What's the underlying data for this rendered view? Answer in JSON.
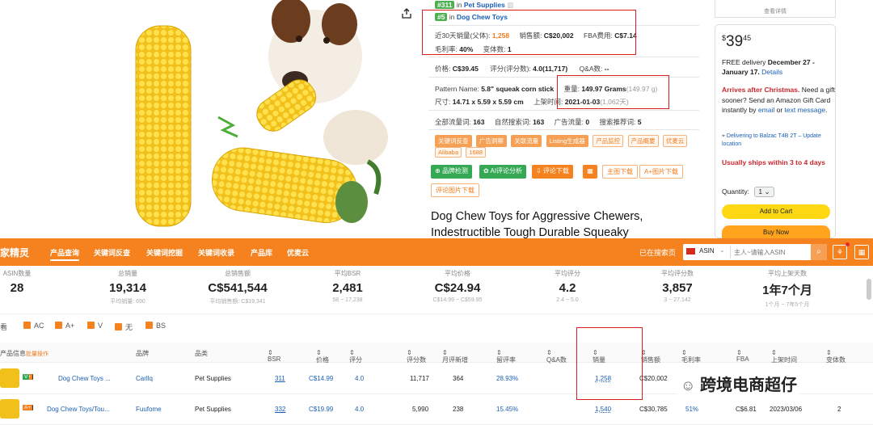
{
  "info": {
    "rank1_tag": "#311",
    "rank1_text": "in",
    "rank1_cat": "Pet Supplies",
    "rank2_tag": "#5",
    "rank2_text": "in",
    "rank2_cat": "Dog Chew Toys",
    "sales30_label": "近30天销量(父体):",
    "sales30_val": "1,258",
    "revenue_label": "销售额:",
    "revenue_val": "C$20,002",
    "fba_label": "FBA费用:",
    "fba_val": "C$7.14",
    "margin_label": "毛利率:",
    "margin_val": "40%",
    "variants_label": "变体数:",
    "variants_val": "1",
    "price_label": "价格:",
    "price_val": "C$39.45",
    "rating_label": "评分(评分数):",
    "rating_val": "4.0(11,717)",
    "qa_label": "Q&A数:",
    "qa_val": "--",
    "pattern_label": "Pattern Name:",
    "pattern_val": "5.8\" squeak corn stick",
    "weight_label": "重量:",
    "weight_val": "149.97 Grams",
    "weight_sub": "(149.97 g)",
    "size_label": "尺寸:",
    "size_val": "14.71 x 5.59 x 5.59 cm",
    "date_label": "上架时间:",
    "date_val": "2021-01-03",
    "date_sub": "(1,062天)",
    "traffic_label": "全部流量词:",
    "traffic_val": "163",
    "organic_label": "自然搜索词:",
    "organic_val": "163",
    "ads_label": "广告流量:",
    "ads_val": "0",
    "rec_label": "搜索推荐词:",
    "rec_val": "5",
    "chips": [
      "关键词反查",
      "广告洞察",
      "关联流量",
      "Listing生成器",
      "产品监控",
      "产品概要",
      "优麦云",
      "Alibaba",
      "1688"
    ],
    "btn_brand": "品牌检测",
    "btn_ai": "AI评论分析",
    "btn_reviews": "评论下载",
    "btn_main": "主图下载",
    "btn_aplus": "A+图片下载",
    "btn_review_img": "评论图片下载"
  },
  "product_title_line1": "Dog Chew Toys for Aggressive Chewers,",
  "product_title_line2": "Indestructible Tough Durable Squeaky",
  "buybox": {
    "top_link": "查看详情",
    "price_sym": "$",
    "price_whole": "39",
    "price_frac": "45",
    "delivery_a": "FREE delivery",
    "delivery_b": "December 27 - January 17.",
    "details": "Details",
    "christmas_a": "Arrives after Christmas.",
    "christmas_b": "Need a gift sooner? Send an Amazon Gift Card instantly by",
    "email": "email",
    "or": "or",
    "text_msg": "text message",
    "deliver_to": "Delivering to Balzac T4B 2T – Update location",
    "ships": "Usually ships within 3 to 4 days",
    "qty_label": "Quantity:",
    "qty_val": "1",
    "add_cart": "Add to Cart",
    "buy_now": "Buy Now"
  },
  "navbar": {
    "logo": "家精灵",
    "items": [
      "产品查询",
      "关键词反查",
      "关键词挖掘",
      "关键词收录",
      "产品库",
      "优麦云"
    ],
    "right_text": "已在搜索页",
    "country": "ASIN",
    "search_placeholder": "主人~请输入ASIN"
  },
  "stats": [
    {
      "label": "ASIN数量",
      "value": "28",
      "sub": ""
    },
    {
      "label": "总销量",
      "value": "19,314",
      "sub": "平均销量: 690"
    },
    {
      "label": "总销售额",
      "value": "C$541,544",
      "sub": "平均销售额: C$19,341"
    },
    {
      "label": "平均BSR",
      "value": "2,481",
      "sub": "58 ~ 17,238"
    },
    {
      "label": "平均价格",
      "value": "C$24.94",
      "sub": "C$14.99 ~ C$59.95"
    },
    {
      "label": "平均评分",
      "value": "4.2",
      "sub": "2.4 ~ 5.0"
    },
    {
      "label": "平均评分数",
      "value": "3,857",
      "sub": "3 ~ 27,142"
    },
    {
      "label": "平均上架天数",
      "value": "1年7个月",
      "sub": "1个月 ~ 7年5个月"
    }
  ],
  "filters": {
    "prefix": "看",
    "items": [
      "AC",
      "A+",
      "V",
      "无",
      "BS"
    ]
  },
  "table": {
    "headers": [
      "产品信息",
      "批量操作",
      "品牌",
      "品类",
      "BSR",
      "价格",
      "评分",
      "评分数",
      "月评新增",
      "留评率",
      "Q&A数",
      "销量",
      "销售额",
      "毛利率",
      "FBA",
      "上架时间",
      "变体数"
    ],
    "rows": [
      {
        "title": "Dog Chew Toys ...",
        "brand": "Carllq",
        "cat": "Pet Supplies",
        "bsr": "311",
        "price": "C$14.99",
        "rating": "4.0",
        "reviews": "11,717",
        "monthly": "364",
        "rate": "28.93%",
        "qa": "",
        "sales": "1,258",
        "revenue": "C$20,002",
        "margin": "",
        "fba": "",
        "date": "",
        "variants": ""
      },
      {
        "title": "Dog Chew Toys/Tou...",
        "brand": "Fuufome",
        "cat": "Pet Supplies",
        "bsr": "332",
        "price": "C$19.99",
        "rating": "4.0",
        "reviews": "5,990",
        "monthly": "238",
        "rate": "15.45%",
        "qa": "",
        "sales": "1,540",
        "revenue": "C$30,785",
        "margin": "51%",
        "fba": "C$6.81",
        "date": "2023/03/06",
        "variants": "2"
      }
    ]
  },
  "watermark": "跨境电商超仔",
  "colors": {
    "orange": "#f5821f",
    "green": "#4caf50",
    "blue": "#1a5fb4",
    "red": "#d81f1f"
  }
}
